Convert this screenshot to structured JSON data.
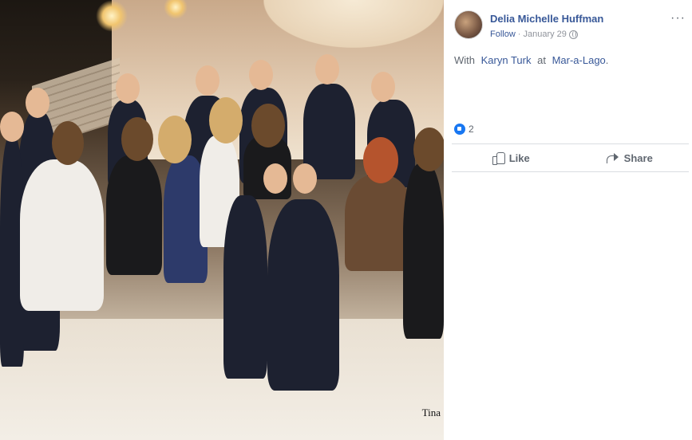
{
  "photo": {
    "watermark": "Tina"
  },
  "post": {
    "author": "Delia Michelle Huffman",
    "follow_label": "Follow",
    "separator": "·",
    "date": "January 29",
    "privacy_icon": "globe-icon",
    "more_label": "···",
    "text_prefix": "With",
    "tagged_person": "Karyn Turk",
    "text_at": "at",
    "location": "Mar-a-Lago",
    "text_suffix": ".",
    "reaction_icon": "like-reaction-icon",
    "reaction_count": "2"
  },
  "actions": {
    "like_label": "Like",
    "share_label": "Share"
  },
  "colors": {
    "link": "#385898",
    "muted": "#606770",
    "meta": "#90949c",
    "like_blue": "#1877f2"
  }
}
